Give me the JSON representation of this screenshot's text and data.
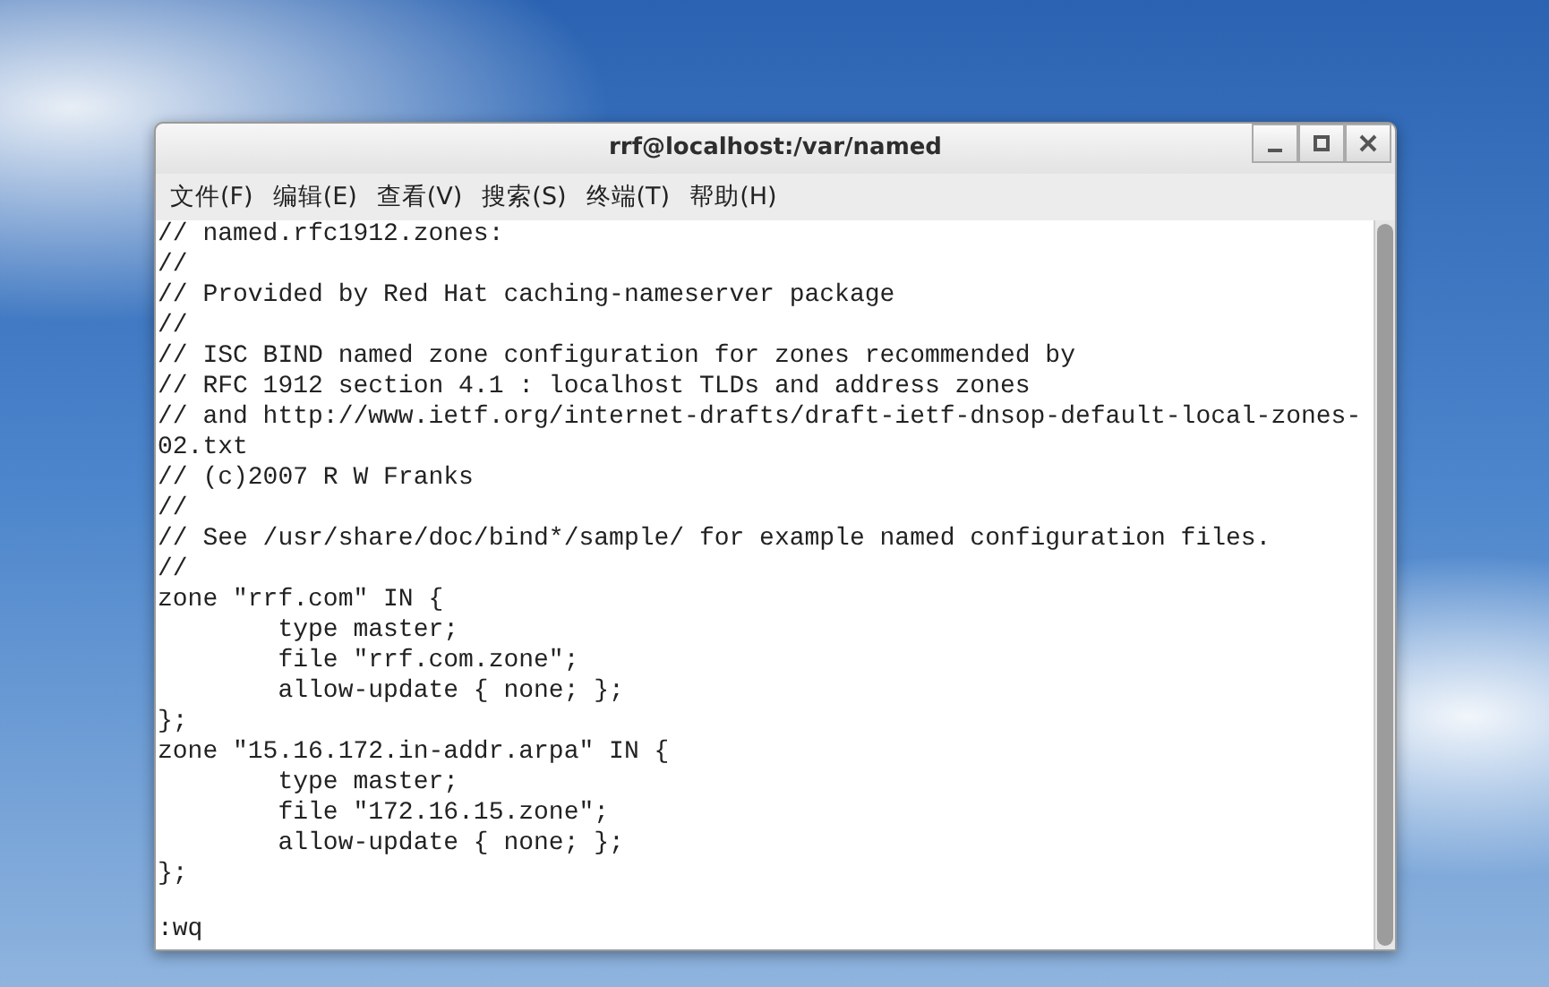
{
  "window": {
    "title": "rrf@localhost:/var/named"
  },
  "menu": [
    {
      "label": "文件(F)"
    },
    {
      "label": "编辑(E)"
    },
    {
      "label": "查看(V)"
    },
    {
      "label": "搜索(S)"
    },
    {
      "label": "终端(T)"
    },
    {
      "label": "帮助(H)"
    }
  ],
  "terminal": {
    "lines": [
      "// named.rfc1912.zones:",
      "//",
      "// Provided by Red Hat caching-nameserver package",
      "//",
      "// ISC BIND named zone configuration for zones recommended by",
      "// RFC 1912 section 4.1 : localhost TLDs and address zones",
      "// and http://www.ietf.org/internet-drafts/draft-ietf-dnsop-default-local-zones-",
      "02.txt",
      "// (c)2007 R W Franks",
      "//",
      "// See /usr/share/doc/bind*/sample/ for example named configuration files.",
      "//",
      "zone \"rrf.com\" IN {",
      "        type master;",
      "        file \"rrf.com.zone\";",
      "        allow-update { none; };",
      "};",
      "zone \"15.16.172.in-addr.arpa\" IN {",
      "        type master;",
      "        file \"172.16.15.zone\";",
      "        allow-update { none; };",
      "};"
    ],
    "command_line": ":wq"
  }
}
